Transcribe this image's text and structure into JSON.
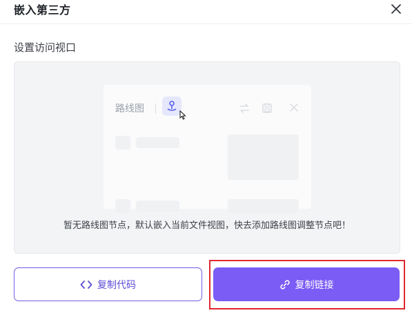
{
  "dialog": {
    "title": "嵌入第三方",
    "close_icon": "close-icon"
  },
  "viewport": {
    "section_label": "设置访问视口",
    "preview": {
      "tab_label": "路线图",
      "pin_icon": "map-pin-icon",
      "action_icons": [
        "swap-icon",
        "save-icon",
        "close-icon"
      ]
    },
    "empty_message": "暂无路线图节点，默认嵌入当前文件视图，快去添加路线图调整节点吧！"
  },
  "buttons": {
    "copy_code": {
      "label": "复制代码",
      "icon": "code-icon"
    },
    "copy_link": {
      "label": "复制链接",
      "icon": "link-icon"
    }
  },
  "colors": {
    "accent": "#7b5cf5",
    "outline": "#6e5ce6",
    "highlight": "#e0282e",
    "preview_bg": "#f3f4f6"
  }
}
